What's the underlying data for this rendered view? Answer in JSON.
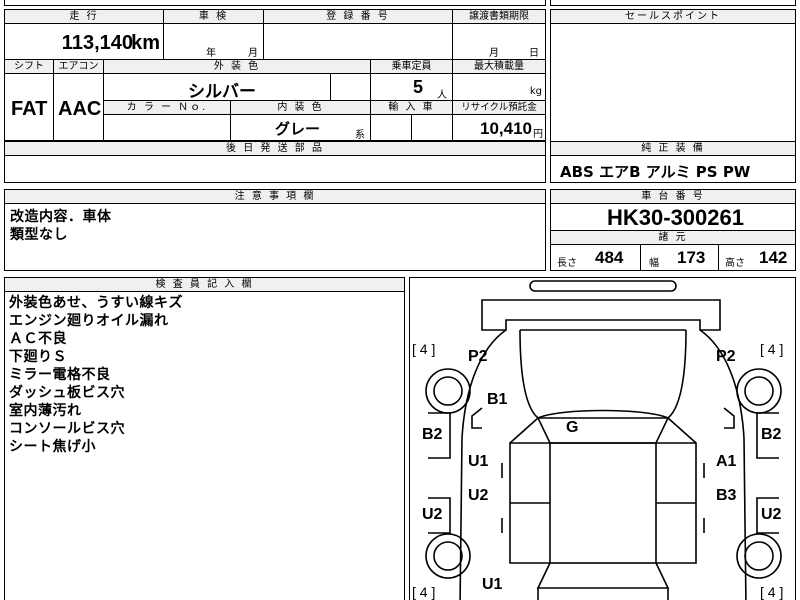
{
  "top_headers": {
    "mileage": "走 行",
    "inspection": "車 検",
    "registration": "登 録 番 号",
    "transfer_deadline": "譲渡書類期限",
    "sales_point": "セールスポイント"
  },
  "mileage": {
    "value": "113,140",
    "unit": "km"
  },
  "inspection": {
    "year_unit": "年",
    "month_unit": "月"
  },
  "transfer": {
    "month_unit": "月",
    "day_unit": "日"
  },
  "row2_headers": {
    "shift": "シフト",
    "aircon": "エアコン",
    "exterior_color": "外 装 色",
    "capacity": "乗車定員",
    "max_load": "最大積載量"
  },
  "shift": "FAT",
  "aircon": "AAC",
  "exterior_color": "シルバー",
  "capacity": {
    "value": "5",
    "unit": "人"
  },
  "max_load": {
    "unit": "kg"
  },
  "row3_headers": {
    "color_no": "カ ラ ー Ｎｏ.",
    "interior_color": "内 装 色",
    "import": "輸 入 車",
    "recycle": "リサイクル預託金"
  },
  "interior_color": {
    "value": "グレー",
    "suffix": "系"
  },
  "recycle": {
    "value": "10,410",
    "unit": "円"
  },
  "later_parts_header": "後 日 発 送 部 品",
  "genuine_equipment": {
    "header": "純 正 装 備",
    "value": "ABS エアB アルミ PS PW"
  },
  "notice_header": "注 意 事 項 欄",
  "notice_lines": [
    "改造内容．車体",
    "類型なし"
  ],
  "chassis": {
    "header": "車 台 番 号",
    "value": "HK30-300261"
  },
  "dimensions": {
    "header": "諸 元",
    "length_label": "長さ",
    "length": "484",
    "width_label": "幅",
    "width": "173",
    "height_label": "高さ",
    "height": "142"
  },
  "inspector_header": "検 査 員 記 入 欄",
  "inspector_notes": [
    "外装色あせ、うすい線キズ",
    "エンジン廻りオイル漏れ",
    "ＡＣ不良",
    "下廻りＳ",
    "ミラー電格不良",
    "ダッシュ板ビス穴",
    "室内薄汚れ",
    "コンソールビス穴",
    "シート焦げ小"
  ],
  "diagram": {
    "tire_tl": "[ 4 ]",
    "tire_tr": "[ 4 ]",
    "tire_bl": "[ 4 ]",
    "tire_br": "[ 4 ]",
    "marks": {
      "p2_left": "P2",
      "p2_right": "P2",
      "b1": "B1",
      "g": "G",
      "b2_left": "B2",
      "b2_right": "B2",
      "u1_left": "U1",
      "a1": "A1",
      "u2_left": "U2",
      "b3": "B3",
      "u2_far_left": "U2",
      "u2_far_right": "U2",
      "u1_bottom": "U1"
    }
  }
}
